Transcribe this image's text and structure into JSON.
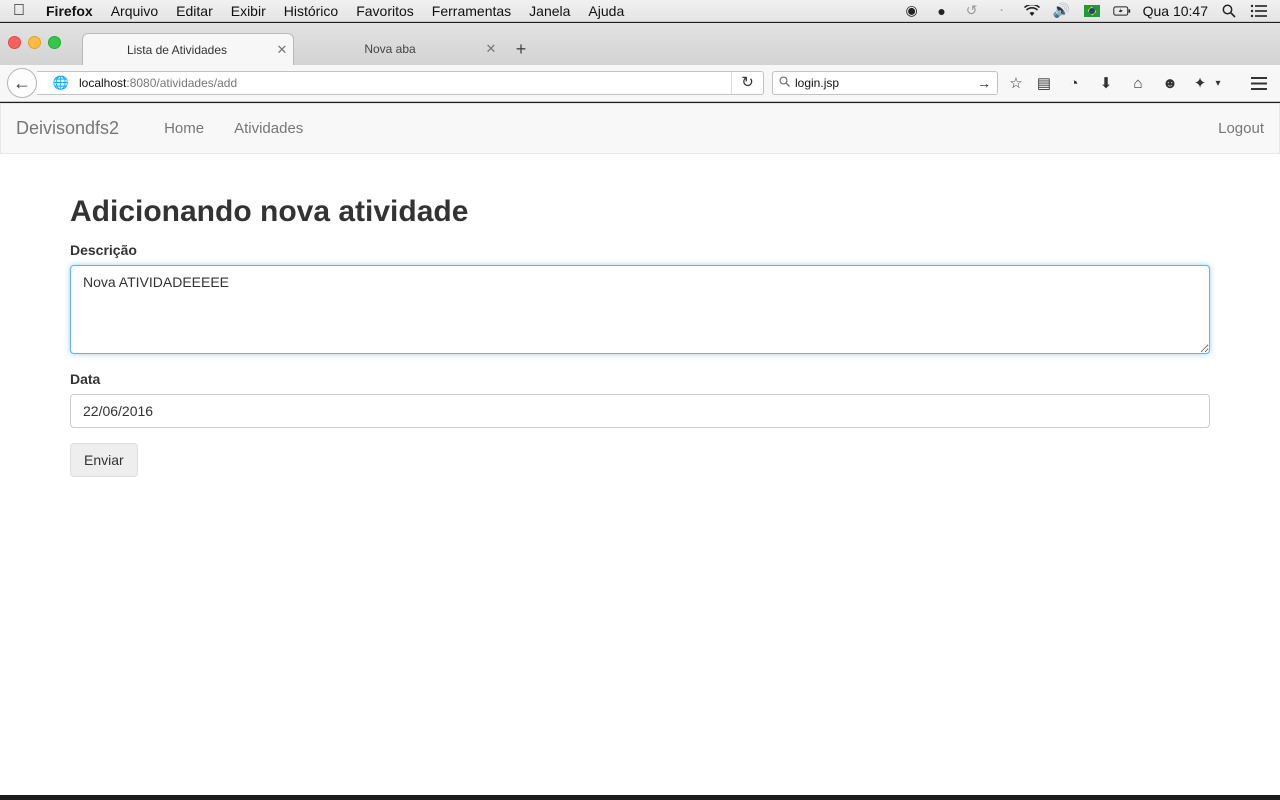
{
  "menubar": {
    "app": "Firefox",
    "items": [
      "Arquivo",
      "Editar",
      "Exibir",
      "Histórico",
      "Favoritos",
      "Ferramentas",
      "Janela",
      "Ajuda"
    ],
    "clock": "Qua 10:47"
  },
  "tabs": [
    {
      "label": "Lista de Atividades",
      "active": true
    },
    {
      "label": "Nova aba",
      "active": false
    }
  ],
  "toolbar": {
    "url_host": "localhost",
    "url_path": ":8080/atividades/add",
    "search_value": "login.jsp"
  },
  "site": {
    "brand": "Deivisondfs2",
    "nav": [
      "Home",
      "Atividades"
    ],
    "logout": "Logout"
  },
  "form": {
    "title": "Adicionando nova atividade",
    "descricao_label": "Descrição",
    "descricao_value": "Nova ATIVIDADEEEEE",
    "data_label": "Data",
    "data_value": "22/06/2016",
    "submit_label": "Enviar"
  }
}
